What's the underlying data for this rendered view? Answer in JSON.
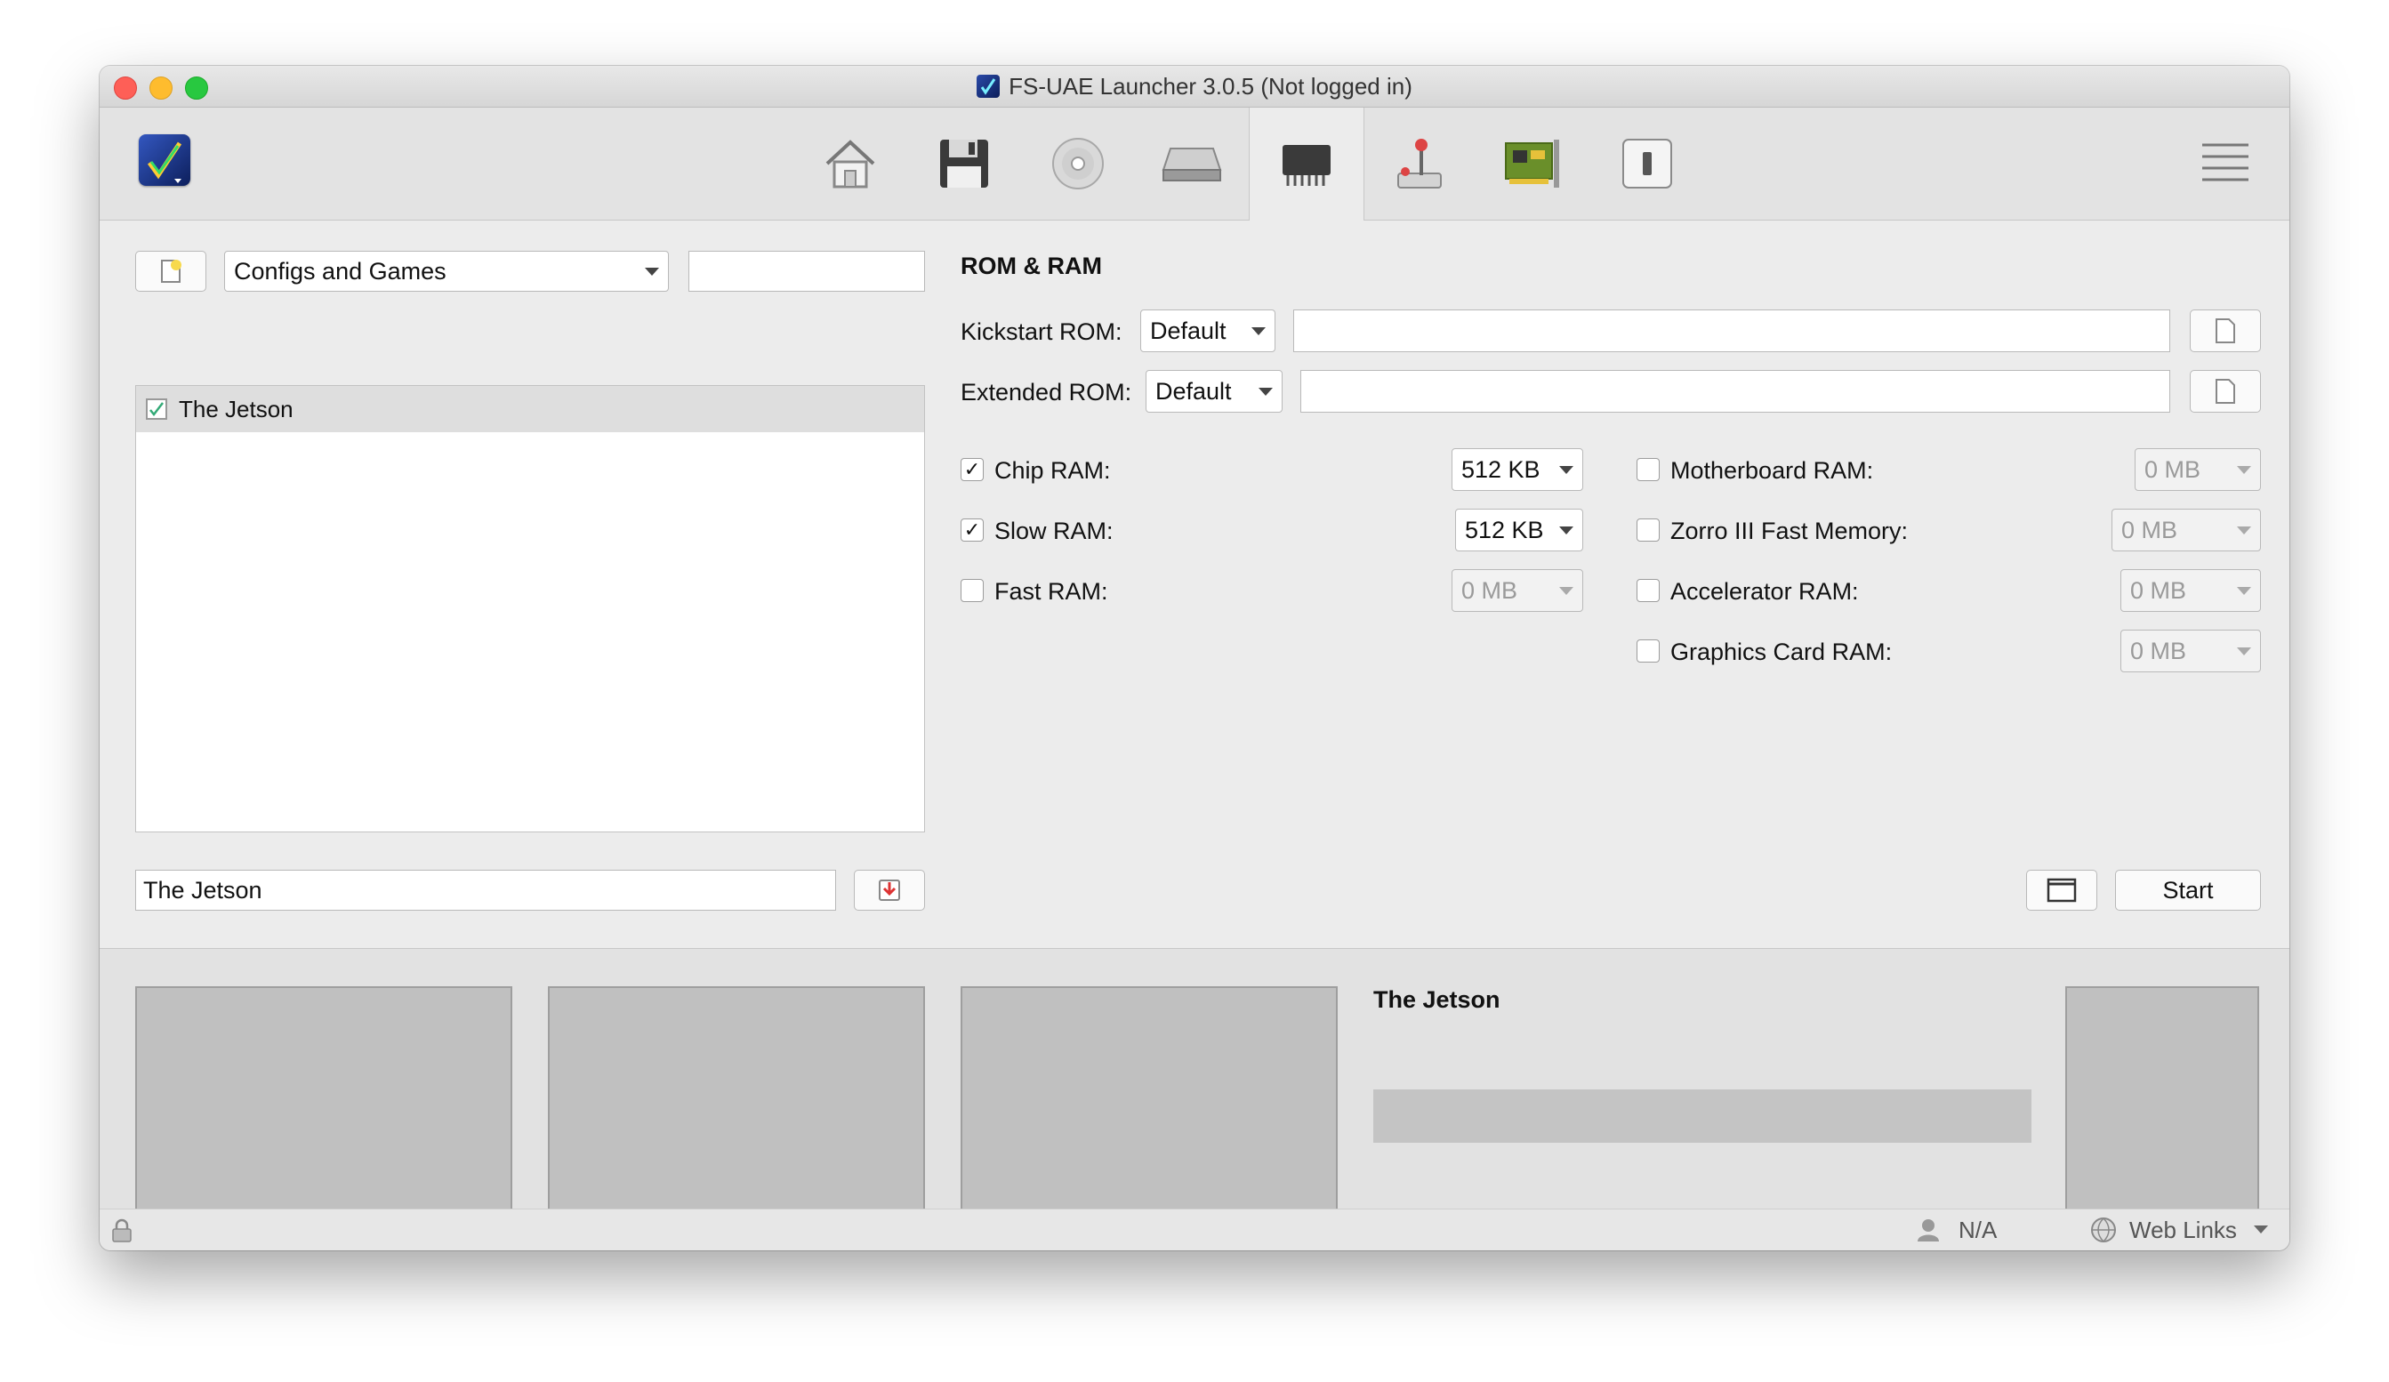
{
  "window": {
    "title": "FS-UAE Launcher 3.0.5 (Not logged in)"
  },
  "toolbar": {
    "tabs": [
      {
        "icon": "home-icon"
      },
      {
        "icon": "floppy-disk-icon"
      },
      {
        "icon": "cd-rom-icon"
      },
      {
        "icon": "hard-drive-icon"
      },
      {
        "icon": "memory-chip-icon",
        "active": true
      },
      {
        "icon": "joystick-icon"
      },
      {
        "icon": "expansion-card-icon"
      },
      {
        "icon": "switch-icon"
      }
    ],
    "menu_icon": "hamburger-menu-icon"
  },
  "left": {
    "list_filter": "Configs and Games",
    "search_value": "",
    "items": [
      {
        "label": "The Jetson",
        "selected": true
      }
    ],
    "config_name": "The Jetson"
  },
  "rom_ram": {
    "title": "ROM & RAM",
    "kickstart_label": "Kickstart ROM:",
    "kickstart_value": "Default",
    "kickstart_path": "",
    "extended_label": "Extended ROM:",
    "extended_value": "Default",
    "extended_path": "",
    "chip_label": "Chip RAM:",
    "chip_value": "512 KB",
    "chip_checked": true,
    "slow_label": "Slow RAM:",
    "slow_value": "512 KB",
    "slow_checked": true,
    "fast_label": "Fast RAM:",
    "fast_value": "0 MB",
    "fast_checked": false,
    "motherboard_label": "Motherboard RAM:",
    "motherboard_value": "0 MB",
    "zorro_label": "Zorro III Fast Memory:",
    "zorro_value": "0 MB",
    "accelerator_label": "Accelerator RAM:",
    "accelerator_value": "0 MB",
    "graphics_label": "Graphics Card RAM:",
    "graphics_value": "0 MB",
    "check_mark": "✓"
  },
  "actions": {
    "start_label": "Start"
  },
  "bottom": {
    "game_title": "The Jetson"
  },
  "status": {
    "user": "N/A",
    "web_links": "Web Links"
  },
  "colors": {
    "window_bg": "#ececec",
    "toolbar_bg": "#e3e3e3",
    "selected_item": "#dedede",
    "screenshot_placeholder": "#c0c0c0",
    "close": "#fe5f57",
    "minimize": "#febc2e",
    "maximize": "#28c840"
  }
}
